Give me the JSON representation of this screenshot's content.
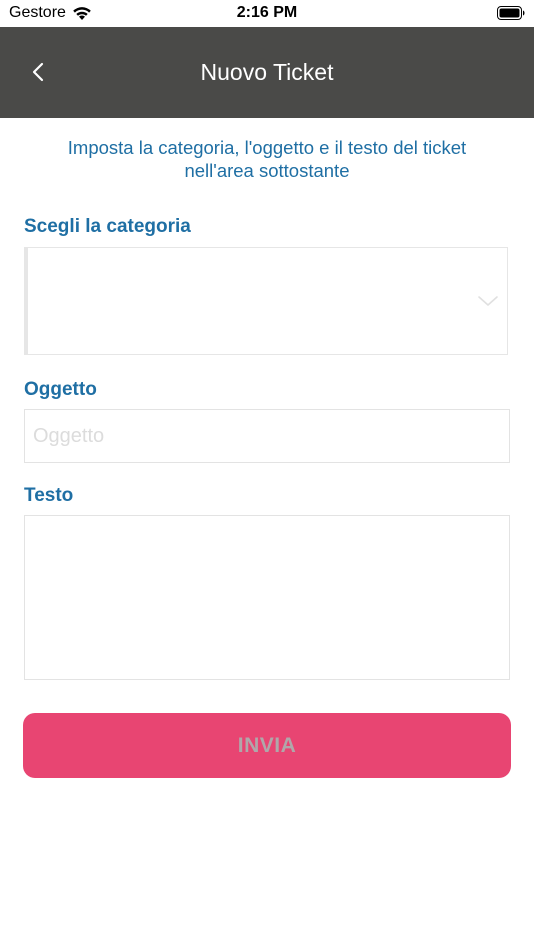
{
  "status_bar": {
    "carrier": "Gestore",
    "time": "2:16 PM",
    "icons": [
      "wifi-icon",
      "battery-icon"
    ]
  },
  "nav_bar": {
    "title": "Nuovo Ticket",
    "back_icon": "chevron-left-icon",
    "background_color": "#4a4a48"
  },
  "intro": {
    "line1": "Imposta la categoria, l'oggetto e il testo del ticket",
    "line2": "nell'area sottostante"
  },
  "category": {
    "label": "Scegli la categoria",
    "selected": "",
    "icon": "chevron-down-icon"
  },
  "subject": {
    "label": "Oggetto",
    "value": "",
    "placeholder": "Oggetto"
  },
  "body_text": {
    "label": "Testo",
    "value": ""
  },
  "submit": {
    "label": "INVIA",
    "color": "#e84572"
  },
  "accent_color": "#1f6fa4"
}
